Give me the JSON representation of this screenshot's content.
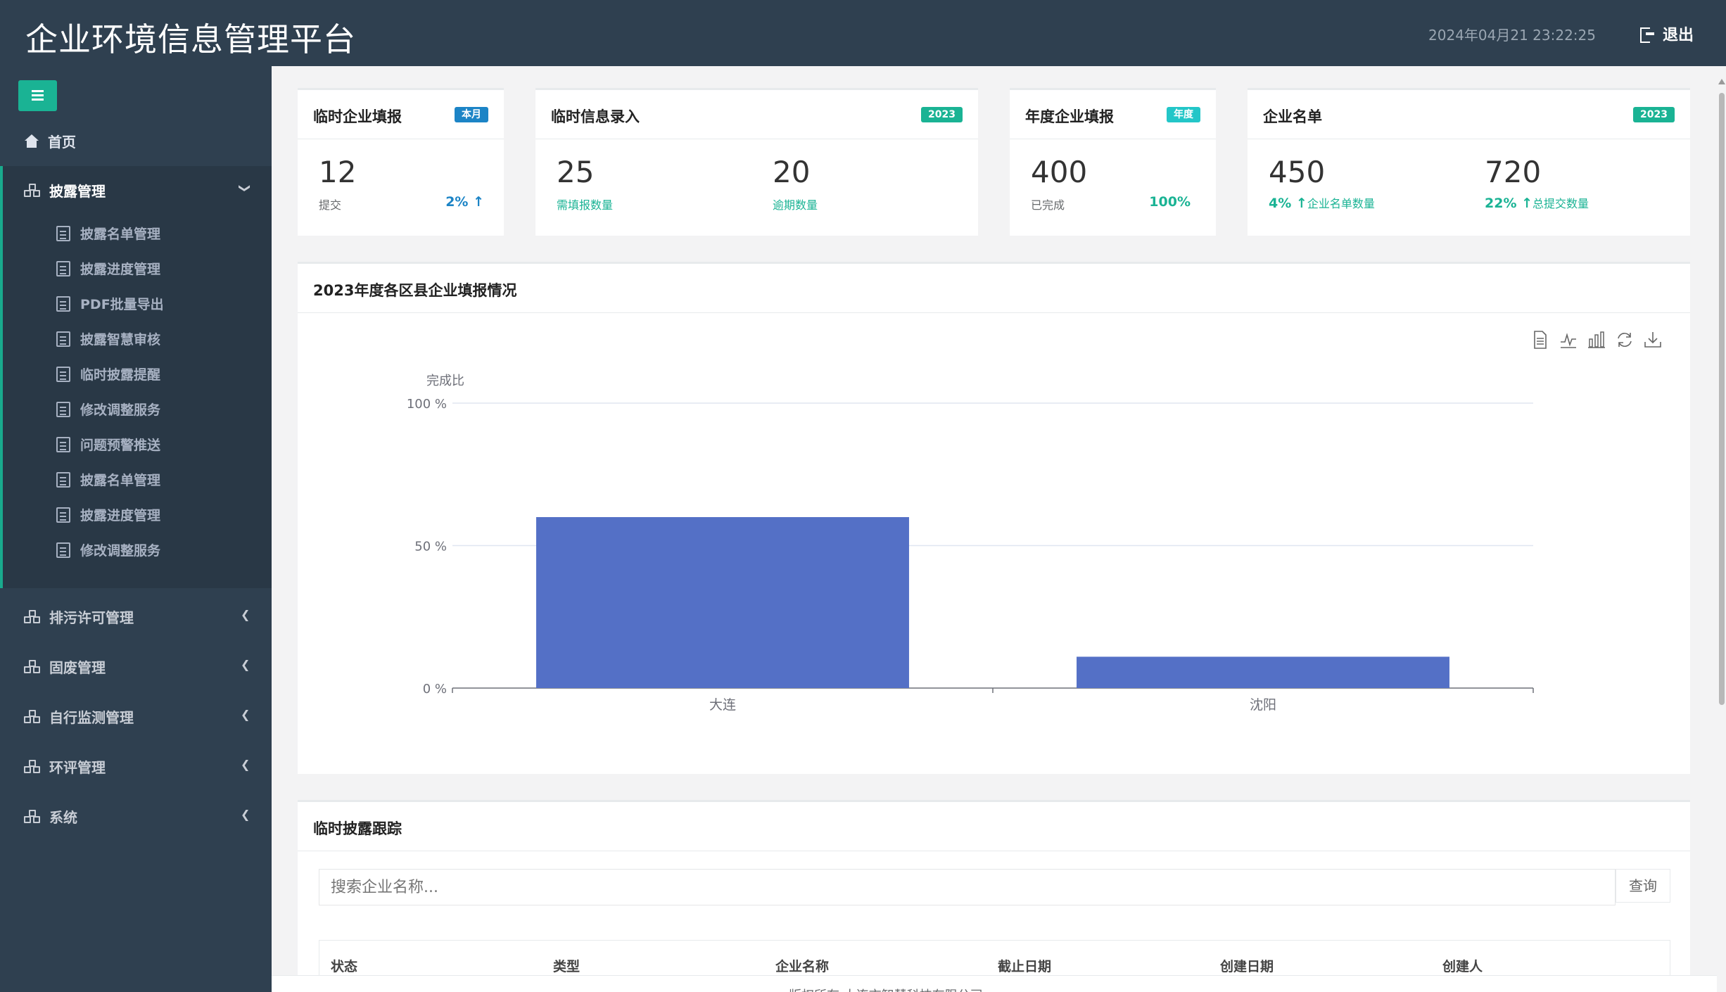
{
  "header": {
    "title": "企业环境信息管理平台",
    "datetime": "2024年04月21 23:22:25",
    "logout_label": "退出"
  },
  "sidebar": {
    "home": "首页",
    "open_group": {
      "label": "披露管理",
      "items": [
        "披露名单管理",
        "披露进度管理",
        "PDF批量导出",
        "披露智慧审核",
        "临时披露提醒",
        "修改调整服务",
        "问题预警推送",
        "披露名单管理",
        "披露进度管理",
        "修改调整服务"
      ]
    },
    "groups": [
      "排污许可管理",
      "固废管理",
      "自行监测管理",
      "环评管理",
      "系统"
    ]
  },
  "stats": {
    "temp_report": {
      "title": "临时企业填报",
      "badge": "本月",
      "value": "12",
      "label": "提交",
      "pct": "2%"
    },
    "temp_entry": {
      "title": "临时信息录入",
      "badge": "2023",
      "value1": "25",
      "label1": "需填报数量",
      "value2": "20",
      "label2": "逾期数量"
    },
    "annual_report": {
      "title": "年度企业填报",
      "badge": "年度",
      "value": "400",
      "label": "已完成",
      "pct": "100%"
    },
    "company_list": {
      "title": "企业名单",
      "badge": "2023",
      "value1": "450",
      "pct1": "4%",
      "label1": "企业名单数量",
      "value2": "720",
      "pct2": "22%",
      "label2": "总提交数量"
    }
  },
  "chart_panel": {
    "title": "2023年度各区县企业填报情况"
  },
  "chart_data": {
    "type": "bar",
    "categories": [
      "大连",
      "沈阳"
    ],
    "values": [
      60,
      11
    ],
    "ylabel": "完成比",
    "ylim": [
      0,
      100
    ],
    "yticks": [
      "0 %",
      "50 %",
      "100 %"
    ],
    "grid": true,
    "bar_color": "#5470c6"
  },
  "chart_tools": [
    "data-view-icon",
    "line-chart-icon",
    "bar-chart-icon",
    "refresh-icon",
    "download-icon"
  ],
  "tracking": {
    "title": "临时披露跟踪",
    "search_placeholder": "搜索企业名称...",
    "query_label": "查询",
    "columns": [
      "状态",
      "类型",
      "企业名称",
      "截止日期",
      "创建日期",
      "创建人"
    ]
  },
  "footer": {
    "text": "版权所有 大连市智慧科技有限公司"
  },
  "colors": {
    "header_bg": "#2f4050",
    "accent_green": "#1ab394",
    "accent_blue": "#1c84c6",
    "accent_teal": "#23c6c8"
  }
}
